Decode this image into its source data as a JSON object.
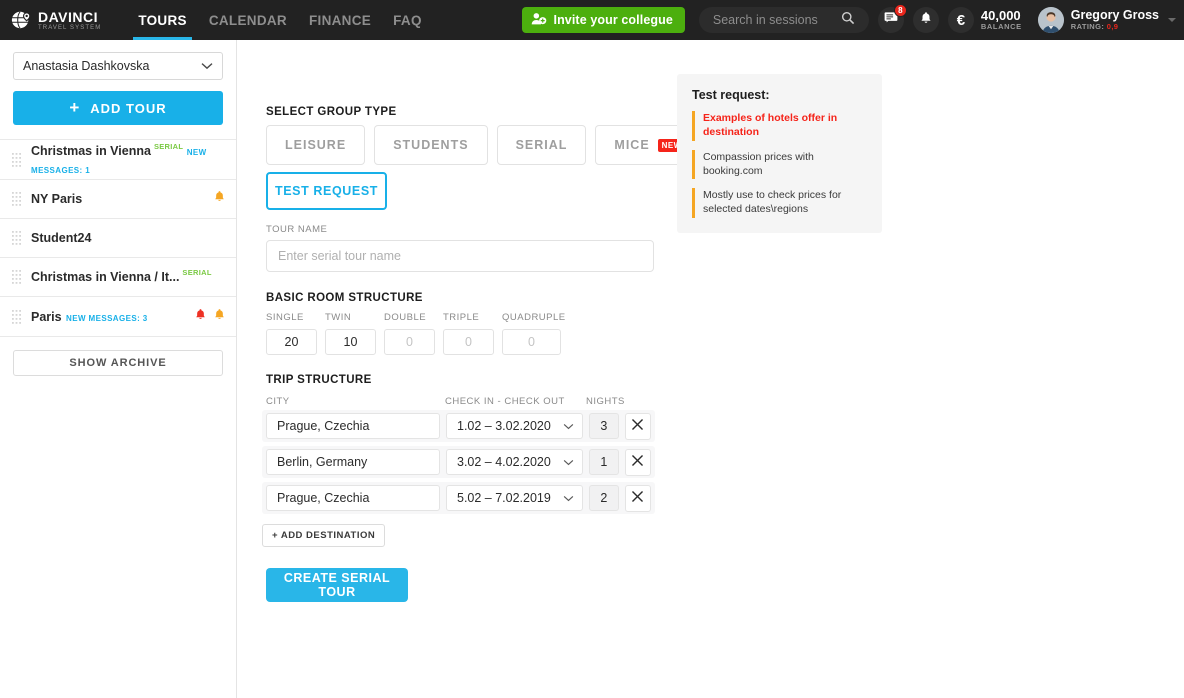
{
  "header": {
    "logo": {
      "name": "DAVINCI",
      "sub": "TRAVEL SYSTEM",
      "icon": "globe-pin-icon"
    },
    "nav": [
      {
        "label": "TOURS",
        "active": true
      },
      {
        "label": "CALENDAR",
        "active": false
      },
      {
        "label": "FINANCE",
        "active": false
      },
      {
        "label": "FAQ",
        "active": false
      }
    ],
    "invite": {
      "label": "Invite your collegue",
      "icon": "add-user-icon",
      "color": "#4caf0e"
    },
    "search": {
      "value": "",
      "placeholder": "Search in sessions",
      "icon": "search-icon"
    },
    "messages": {
      "icon": "chat-icon",
      "badge": "8",
      "badge_color": "#e8261c"
    },
    "notifications": {
      "icon": "bell-icon"
    },
    "currency": {
      "icon": "euro-icon",
      "symbol": "€"
    },
    "balance": {
      "amount": "40,000",
      "label": "BALANCE"
    },
    "user": {
      "name": "Gregory Gross",
      "rating_label": "RATING:",
      "rating_value": "0,9",
      "avatar": "user-avatar",
      "caret": "chevron-down-icon"
    }
  },
  "sidebar": {
    "manager_select": {
      "value": "Anastasia Dashkovska",
      "icon": "chevron-down-icon"
    },
    "add_tour_label": "ADD TOUR",
    "add_tour_icon": "plus-icon",
    "tours": [
      {
        "title": "Christmas in Vienna",
        "tag": "SERIAL",
        "messages": "NEW MESSAGES: 1",
        "bells": []
      },
      {
        "title": "NY Paris",
        "tag": "",
        "messages": "",
        "bells": [
          "orange"
        ]
      },
      {
        "title": "Student24",
        "tag": "",
        "messages": "",
        "bells": []
      },
      {
        "title": "Christmas in Vienna / It...",
        "tag": "SERIAL",
        "messages": "",
        "bells": []
      },
      {
        "title": "Paris",
        "tag": "",
        "messages": "NEW MESSAGES: 3",
        "bells": [
          "red",
          "orange"
        ]
      }
    ],
    "show_archive_label": "SHOW ARCHIVE"
  },
  "main": {
    "group_type": {
      "label": "SELECT GROUP TYPE",
      "options": [
        {
          "label": "LEISURE",
          "badge": ""
        },
        {
          "label": "STUDENTS",
          "badge": ""
        },
        {
          "label": "SERIAL",
          "badge": ""
        },
        {
          "label": "MICE",
          "badge": "NEW"
        }
      ],
      "test_request_label": "TEST REQUEST"
    },
    "tour_name": {
      "label": "TOUR NAME",
      "value": "",
      "placeholder": "Enter serial tour name"
    },
    "room_structure": {
      "label": "BASIC ROOM STRUCTURE",
      "fields": [
        {
          "label": "SINGLE",
          "value": "20",
          "placeholder": "0"
        },
        {
          "label": "TWIN",
          "value": "10",
          "placeholder": "0"
        },
        {
          "label": "DOUBLE",
          "value": "",
          "placeholder": "0"
        },
        {
          "label": "TRIPLE",
          "value": "",
          "placeholder": "0"
        },
        {
          "label": "QUADRUPLE",
          "value": "",
          "placeholder": "0"
        }
      ]
    },
    "trip_structure": {
      "label": "TRIP STRUCTURE",
      "columns": [
        "CITY",
        "CHECK IN - CHECK OUT",
        "NIGHTS"
      ],
      "rows": [
        {
          "city": "Prague, Czechia",
          "dates": "1.02 – 3.02.2020",
          "nights": "3"
        },
        {
          "city": "Berlin, Germany",
          "dates": "3.02 – 4.02.2020",
          "nights": "1"
        },
        {
          "city": "Prague, Czechia",
          "dates": "5.02 – 7.02.2019",
          "nights": "2"
        }
      ],
      "add_destination_label": "+ ADD DESTINATION",
      "delete_icon": "close-icon"
    },
    "create_label": "CREATE SERIAL TOUR"
  },
  "test_request_panel": {
    "title": "Test request:",
    "items": [
      {
        "text": "Examples of hotels offer in destination",
        "highlight": true
      },
      {
        "text": "Compassion prices with booking.com",
        "highlight": false
      },
      {
        "text": "Mostly use to check prices for selected dates\\regions",
        "highlight": false
      }
    ]
  }
}
